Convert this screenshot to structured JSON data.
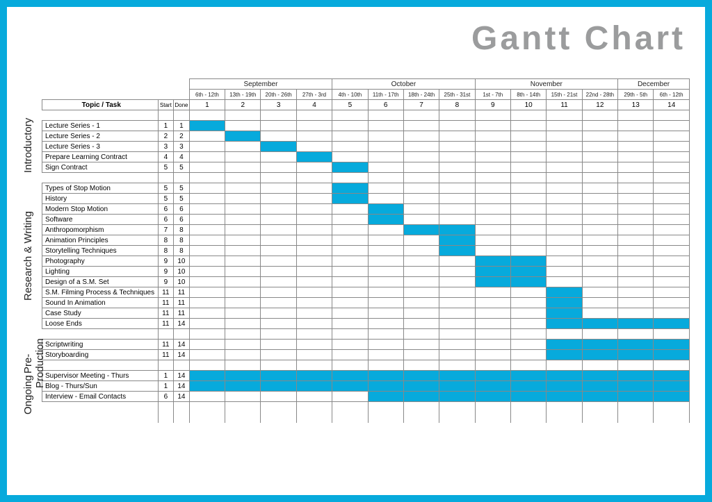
{
  "chart_data": {
    "type": "gantt",
    "title": "Gantt Chart",
    "columns": {
      "task": "Topic / Task",
      "start": "Start",
      "done": "Done"
    },
    "months": [
      {
        "name": "September",
        "span": 4
      },
      {
        "name": "October",
        "span": 4
      },
      {
        "name": "November",
        "span": 4
      },
      {
        "name": "December",
        "span": 2
      }
    ],
    "weeks": [
      {
        "n": 1,
        "range": "6th - 12th"
      },
      {
        "n": 2,
        "range": "13th - 19th"
      },
      {
        "n": 3,
        "range": "20th - 26th"
      },
      {
        "n": 4,
        "range": "27th - 3rd"
      },
      {
        "n": 5,
        "range": "4th - 10th"
      },
      {
        "n": 6,
        "range": "11th - 17th"
      },
      {
        "n": 7,
        "range": "18th - 24th"
      },
      {
        "n": 8,
        "range": "25th - 31st"
      },
      {
        "n": 9,
        "range": "1st - 7th"
      },
      {
        "n": 10,
        "range": "8th - 14th"
      },
      {
        "n": 11,
        "range": "15th - 21st"
      },
      {
        "n": 12,
        "range": "22nd - 28th"
      },
      {
        "n": 13,
        "range": "29th - 5th"
      },
      {
        "n": 14,
        "range": "6th - 12th"
      }
    ],
    "groups": [
      {
        "name": "Introductory",
        "tasks": [
          {
            "name": "Lecture Series - 1",
            "start": 1,
            "done": 1
          },
          {
            "name": "Lecture Series - 2",
            "start": 2,
            "done": 2
          },
          {
            "name": "Lecture Series - 3",
            "start": 3,
            "done": 3
          },
          {
            "name": "Prepare Learning Contract",
            "start": 4,
            "done": 4
          },
          {
            "name": "Sign Contract",
            "start": 5,
            "done": 5
          }
        ]
      },
      {
        "name": "Research & Writing",
        "tasks": [
          {
            "name": "Types of Stop Motion",
            "start": 5,
            "done": 5
          },
          {
            "name": "History",
            "start": 5,
            "done": 5
          },
          {
            "name": "Modern Stop Motion",
            "start": 6,
            "done": 6
          },
          {
            "name": "Software",
            "start": 6,
            "done": 6
          },
          {
            "name": "Anthropomorphism",
            "start": 7,
            "done": 8
          },
          {
            "name": "Animation Principles",
            "start": 8,
            "done": 8
          },
          {
            "name": "Storytelling Techniques",
            "start": 8,
            "done": 8
          },
          {
            "name": "Photography",
            "start": 9,
            "done": 10
          },
          {
            "name": "Lighting",
            "start": 9,
            "done": 10
          },
          {
            "name": "Design of a S.M. Set",
            "start": 9,
            "done": 10
          },
          {
            "name": "S.M. Filming Process & Techniques",
            "start": 11,
            "done": 11
          },
          {
            "name": "Sound In Animation",
            "start": 11,
            "done": 11
          },
          {
            "name": "Case Study",
            "start": 11,
            "done": 11
          },
          {
            "name": "Loose Ends",
            "start": 11,
            "done": 14
          }
        ]
      },
      {
        "name": "Pre-Production",
        "tasks": [
          {
            "name": "Scriptwriting",
            "start": 11,
            "done": 14
          },
          {
            "name": "Storyboarding",
            "start": 11,
            "done": 14
          }
        ]
      },
      {
        "name": "Ongoing",
        "tasks": [
          {
            "name": "Supervisor Meeting - Thurs",
            "start": 1,
            "done": 14
          },
          {
            "name": "Blog - Thurs/Sun",
            "start": 1,
            "done": 14
          },
          {
            "name": "Interview - Email Contacts",
            "start": 6,
            "done": 14
          }
        ]
      }
    ]
  }
}
